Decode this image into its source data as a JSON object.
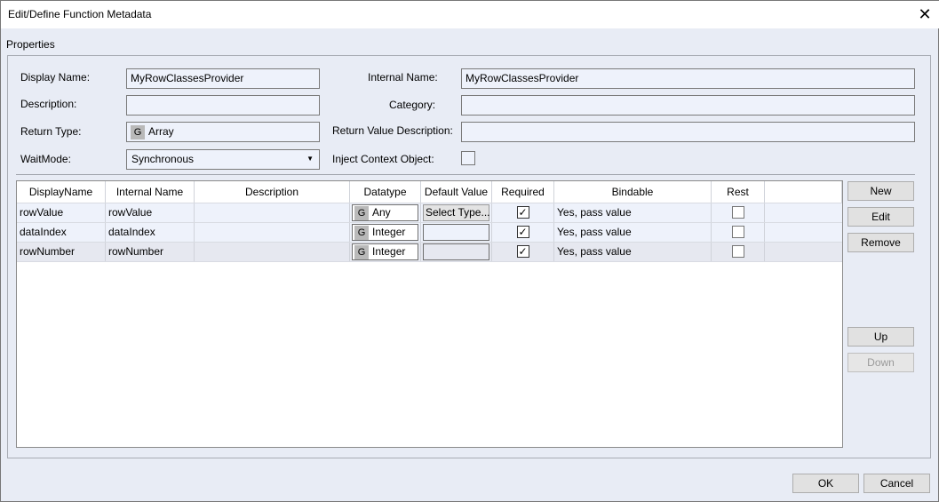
{
  "window": {
    "title": "Edit/Define Function Metadata",
    "close_icon": "close-icon"
  },
  "group_label": "Properties",
  "form": {
    "display_name_label": "Display Name:",
    "display_name": "MyRowClassesProvider",
    "internal_name_label": "Internal Name:",
    "internal_name": "MyRowClassesProvider",
    "description_label": "Description:",
    "description": "",
    "category_label": "Category:",
    "category": "",
    "return_type_label": "Return Type:",
    "return_type_badge": "G",
    "return_type": "Array",
    "return_value_description_label": "Return Value Description:",
    "return_value_description": "",
    "waitmode_label": "WaitMode:",
    "waitmode": "Synchronous",
    "inject_context_label": "Inject Context Object:",
    "inject_context": false
  },
  "grid": {
    "columns": [
      "DisplayName",
      "Internal Name",
      "Description",
      "Datatype",
      "Default Value",
      "Required",
      "Bindable",
      "Rest",
      ""
    ],
    "rows": [
      {
        "display": "rowValue",
        "internal": "rowValue",
        "description": "",
        "badge": "G",
        "datatype": "Any",
        "default": "Select Type...",
        "required": true,
        "bindable": "Yes, pass value",
        "rest": false
      },
      {
        "display": "dataIndex",
        "internal": "dataIndex",
        "description": "",
        "badge": "G",
        "datatype": "Integer",
        "default": "",
        "required": true,
        "bindable": "Yes, pass value",
        "rest": false
      },
      {
        "display": "rowNumber",
        "internal": "rowNumber",
        "description": "",
        "badge": "G",
        "datatype": "Integer",
        "default": "",
        "required": true,
        "bindable": "Yes, pass value",
        "rest": false
      }
    ]
  },
  "side_buttons": {
    "new": "New",
    "edit": "Edit",
    "remove": "Remove",
    "up": "Up",
    "down": "Down"
  },
  "footer": {
    "ok": "OK",
    "cancel": "Cancel"
  }
}
